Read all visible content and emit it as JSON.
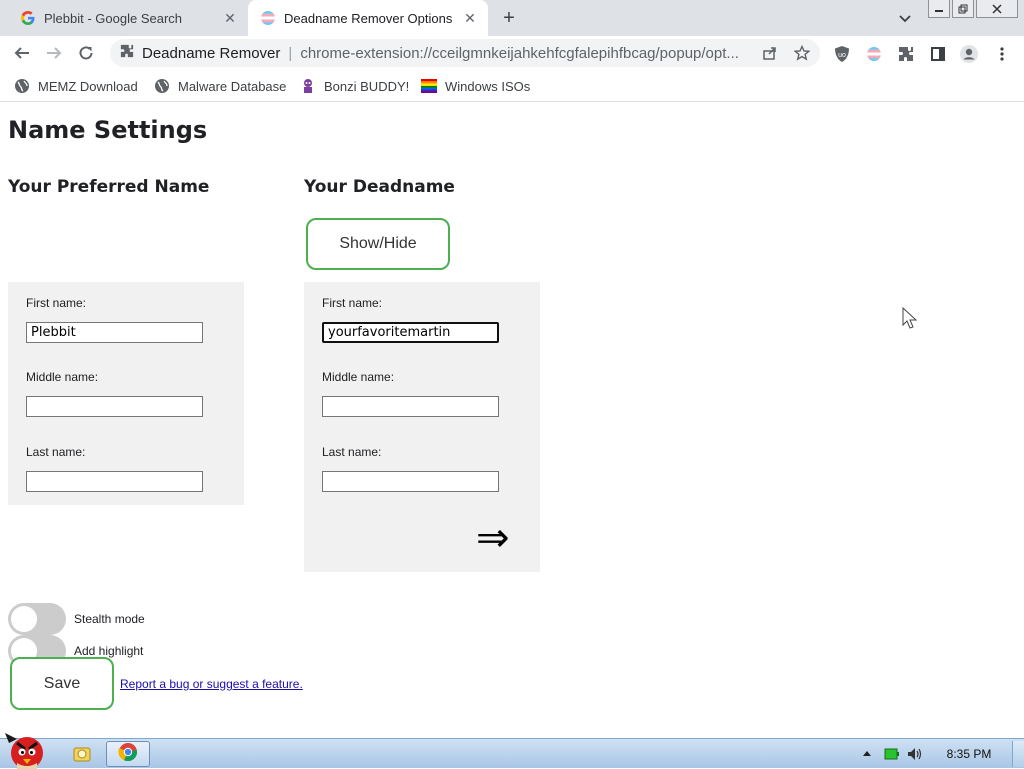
{
  "browser": {
    "tabs": [
      {
        "title": "Plebbit - Google Search",
        "icon": "google-g-icon",
        "active": false
      },
      {
        "title": "Deadname Remover Options",
        "icon": "trans-flag-icon",
        "active": true
      }
    ],
    "newtab_symbol": "+",
    "close_symbol": "✕",
    "omnibox": {
      "ext_name": "Deadname Remover",
      "separator": "|",
      "url": "chrome-extension://cceilgmnkeijahkehfcgfalepihfbcag/popup/opt..."
    },
    "bookmarks": [
      {
        "label": "MEMZ Download",
        "icon": "globe-icon"
      },
      {
        "label": "Malware Database",
        "icon": "globe-icon"
      },
      {
        "label": "Bonzi BUDDY!",
        "icon": "bonzi-icon"
      },
      {
        "label": "Windows ISOs",
        "icon": "rainbow-flag-icon"
      }
    ]
  },
  "page": {
    "title": "Name Settings",
    "preferred": {
      "heading": "Your Preferred Name",
      "first_label": "First name:",
      "first_value": "Plebbit",
      "middle_label": "Middle name:",
      "middle_value": "",
      "last_label": "Last name:",
      "last_value": ""
    },
    "deadname": {
      "heading": "Your Deadname",
      "showhide_label": "Show/Hide",
      "first_label": "First name:",
      "first_value": "yourfavoritemartin",
      "middle_label": "Middle name:",
      "middle_value": "",
      "last_label": "Last name:",
      "last_value": "",
      "arrow": "⇒"
    },
    "toggles": [
      {
        "label": "Stealth mode",
        "on": false
      },
      {
        "label": "Add highlight",
        "on": false
      }
    ],
    "save_label": "Save",
    "bug_link": "Report a bug or suggest a feature."
  },
  "taskbar": {
    "clock": "8:35 PM"
  },
  "colors": {
    "accent_green": "#4caf50",
    "panel_bg": "#f1f1f1",
    "toggle_off": "#cccccc",
    "tab_strip": "#dee1e6",
    "link": "#1a0dab"
  }
}
